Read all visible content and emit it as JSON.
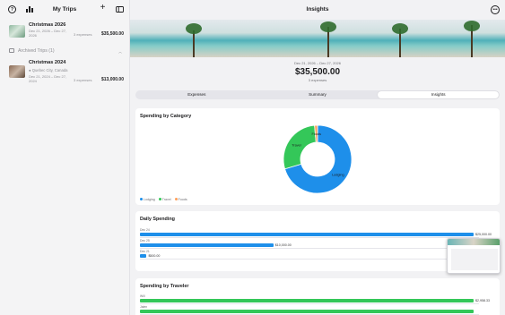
{
  "sidebar": {
    "title": "My Trips",
    "trips": [
      {
        "name": "Christmas 2026",
        "dates": "Dec 21, 2026 – Dec 27, 2026",
        "expenses": "3 expenses",
        "total": "$35,500.00"
      }
    ],
    "archived_label": "Archived Trips (1)",
    "archived": [
      {
        "name": "Christmas 2024",
        "location": "Quebec City, Canada",
        "dates": "Dec 21, 2024 – Dec 27, 2024",
        "expenses": "3 expenses",
        "total": "$13,000.00"
      }
    ]
  },
  "main": {
    "title": "Insights",
    "summary": {
      "dates": "Dec 21, 2026 – Dec 27, 2026",
      "total": "$35,500.00",
      "expenses": "3 expenses"
    },
    "tabs": [
      {
        "label": "Expenses"
      },
      {
        "label": "Summary"
      },
      {
        "label": "Insights",
        "active": true
      }
    ],
    "spending_by_category": {
      "title": "Spending by Category",
      "chart_data": {
        "type": "pie",
        "labels": [
          "Lodging",
          "Travel",
          "Foods"
        ],
        "values": [
          25000,
          10000,
          500
        ],
        "colors": [
          "#1e8fea",
          "#34c759",
          "#ff9f5a"
        ],
        "legend": "bottom-left"
      }
    },
    "daily_spending": {
      "title": "Daily Spending",
      "chart_data": {
        "type": "bar",
        "categories": [
          "Dec 24",
          "Dec 25",
          "Dec 21"
        ],
        "values": [
          25000,
          10000,
          500
        ],
        "value_labels": [
          "$25,000.00",
          "$10,000.00",
          "$500.00"
        ],
        "color": "#1e8fea",
        "max": 25000
      }
    },
    "spending_by_traveler": {
      "title": "Spending by Traveler",
      "chart_data": {
        "type": "bar",
        "categories": [
          "Will",
          "Jalen"
        ],
        "values": [
          2958.33,
          2958.33
        ],
        "value_labels": [
          "$2,958.33",
          ""
        ],
        "color": "#34c759",
        "max": 2958.33
      }
    }
  },
  "colors": {
    "accent": "#1e8fea",
    "green": "#34c759",
    "orange": "#ff9f5a"
  }
}
